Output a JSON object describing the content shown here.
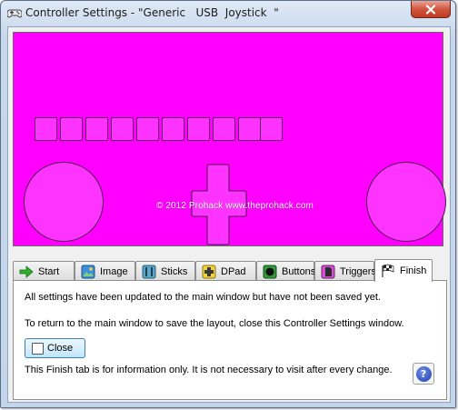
{
  "window": {
    "title": "Controller Settings - \"Generic   USB  Joystick  \"",
    "close_glyph": "x"
  },
  "canvas": {
    "background_color": "#ff00ff",
    "button_count": 10,
    "watermark": "© 2012 Prohack www.theprohack.com"
  },
  "tabs": [
    {
      "label": "Start",
      "icon": "arrow-right-icon"
    },
    {
      "label": "Image",
      "icon": "image-icon"
    },
    {
      "label": "Sticks",
      "icon": "sticks-icon"
    },
    {
      "label": "DPad",
      "icon": "dpad-icon"
    },
    {
      "label": "Buttons",
      "icon": "buttons-icon"
    },
    {
      "label": "Triggers",
      "icon": "triggers-icon"
    },
    {
      "label": "Finish",
      "icon": "checkered-flag-icon",
      "active": true
    }
  ],
  "finish": {
    "line1": "All settings have been updated to the main window but have not been saved yet.",
    "line2": "To return to the main window to save the layout, close this Controller Settings window.",
    "close_label": "Close",
    "line3": "This Finish tab is for information only. It is not necessary to visit after every change.",
    "help_glyph": "?"
  }
}
